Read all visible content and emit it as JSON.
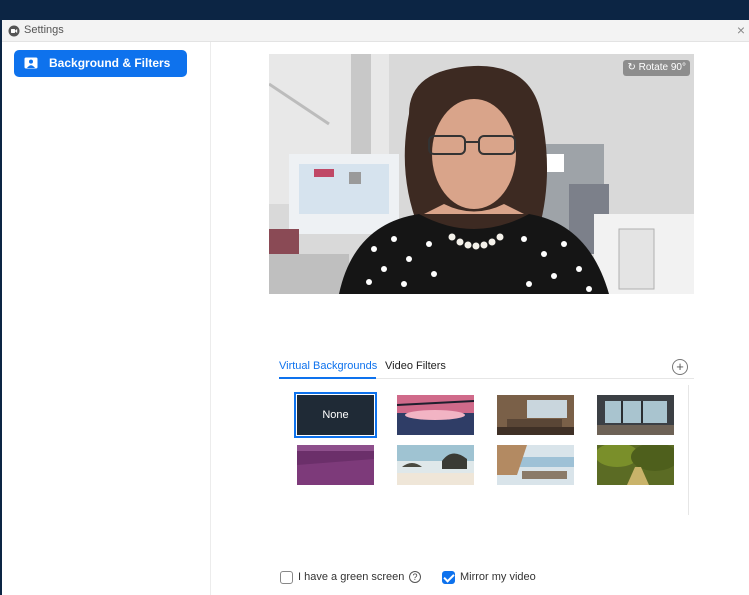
{
  "window": {
    "title": "Settings",
    "close_symbol": "×",
    "app_icon": "zoom-logo-icon"
  },
  "sidebar": {
    "items": [
      {
        "label": "Background & Filters",
        "icon": "person-frame-icon",
        "selected": true
      }
    ]
  },
  "preview": {
    "rotate_label": "Rotate 90°",
    "rotate_icon": "rotate-icon"
  },
  "tabs": [
    {
      "label": "Virtual Backgrounds",
      "active": true
    },
    {
      "label": "Video Filters",
      "active": false
    }
  ],
  "add_button": {
    "icon": "add-circle-icon",
    "symbol": "+"
  },
  "backgrounds": [
    {
      "label": "None",
      "selected": true
    },
    {
      "name": "sunset-bridge",
      "selected": false
    },
    {
      "name": "office-interior",
      "selected": false
    },
    {
      "name": "glass-room",
      "selected": false
    },
    {
      "name": "lavender-field",
      "selected": false
    },
    {
      "name": "beach-rocks",
      "selected": false
    },
    {
      "name": "seaside-terrace",
      "selected": false
    },
    {
      "name": "forest-path",
      "selected": false
    }
  ],
  "footer": {
    "green_screen_label": "I have a green screen",
    "green_screen_checked": false,
    "mirror_label": "Mirror my video",
    "mirror_checked": true,
    "help_symbol": "?"
  },
  "colors": {
    "accent": "#0e72ed",
    "frame": "#0c2544"
  }
}
